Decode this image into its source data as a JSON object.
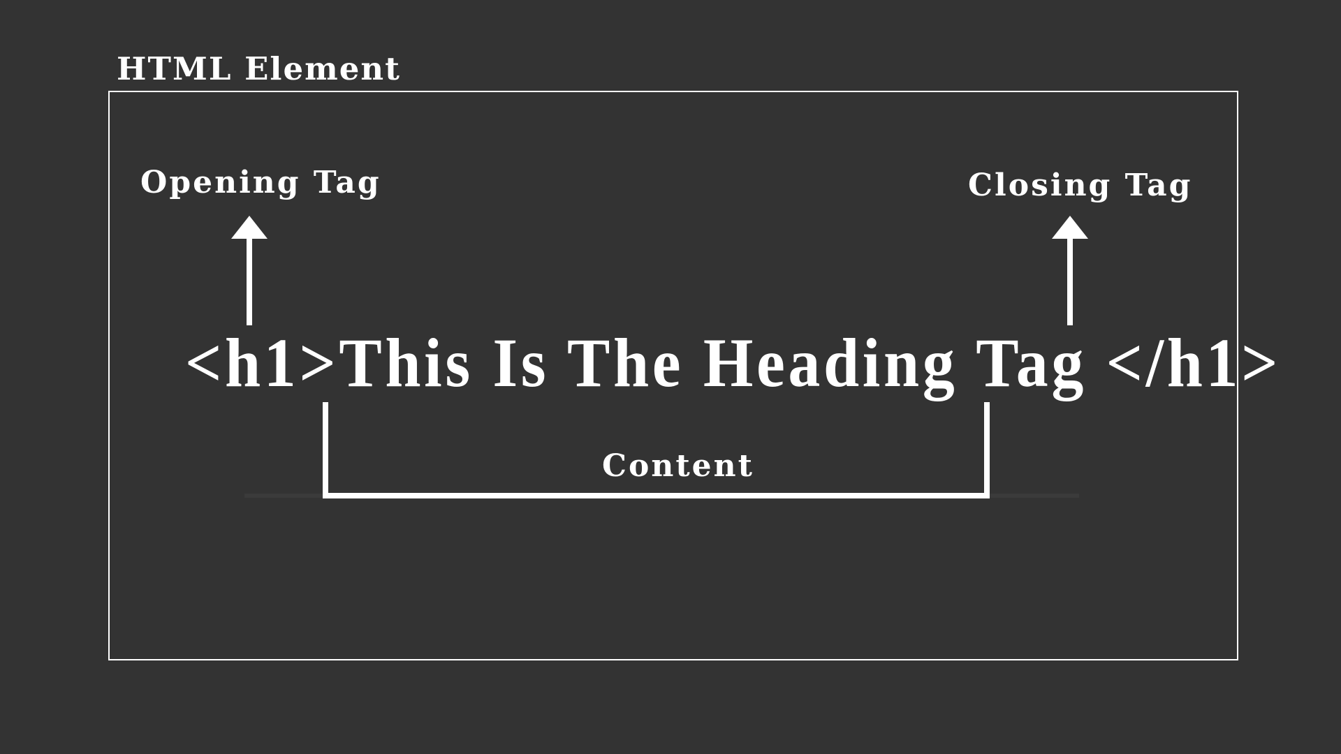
{
  "title": "HTML Element",
  "labels": {
    "opening": "Opening Tag",
    "closing": "Closing Tag",
    "content": "Content"
  },
  "code": {
    "open_tag": "<h1>",
    "content": "This Is The Heading Tag",
    "close_tag": "</h1>"
  },
  "colors": {
    "background": "#333333",
    "foreground": "#ffffff"
  }
}
